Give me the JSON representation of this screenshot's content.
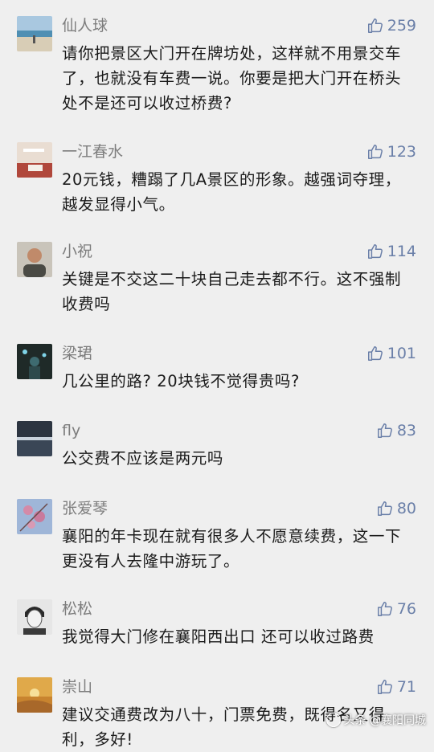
{
  "comments": [
    {
      "username": "仙人球",
      "likes": "259",
      "text": "请你把景区大门开在牌坊处，这样就不用景交车了，也就没有车费一说。你要是把大门开在桥头处不是还可以收过桥费?",
      "avatar_icon": "beach-avatar"
    },
    {
      "username": "一江春水",
      "likes": "123",
      "text": "20元钱，糟蹋了几A景区的形象。越强词夺理，越发显得小气。",
      "avatar_icon": "lamp-avatar"
    },
    {
      "username": "小祝",
      "likes": "114",
      "text": "关键是不交这二十块自己走去都不行。这不强制收费吗",
      "avatar_icon": "man-photo-avatar"
    },
    {
      "username": "梁珺",
      "likes": "101",
      "text": "几公里的路? 20块钱不觉得贵吗?",
      "avatar_icon": "night-figure-avatar"
    },
    {
      "username": "fly",
      "likes": "83",
      "text": "公交费不应该是两元吗",
      "avatar_icon": "sunset-water-avatar"
    },
    {
      "username": "张爱琴",
      "likes": "80",
      "text": "襄阳的年卡现在就有很多人不愿意续费，这一下更没有人去隆中游玩了。",
      "avatar_icon": "blossom-avatar"
    },
    {
      "username": "松松",
      "likes": "76",
      "text": "我觉得大门修在襄阳西出口 还可以收过路费",
      "avatar_icon": "sketch-portrait-avatar"
    },
    {
      "username": "崇山",
      "likes": "71",
      "text": "建议交通费改为八十，门票免费，既得名又得利，多好!",
      "avatar_icon": "desert-sunset-avatar"
    }
  ],
  "watermark": {
    "text": "头条 @襄阳同城"
  },
  "colors": {
    "background": "#efefef",
    "username": "#7d7d7d",
    "likes": "#6a7fa8",
    "text": "#1a1a1a"
  }
}
